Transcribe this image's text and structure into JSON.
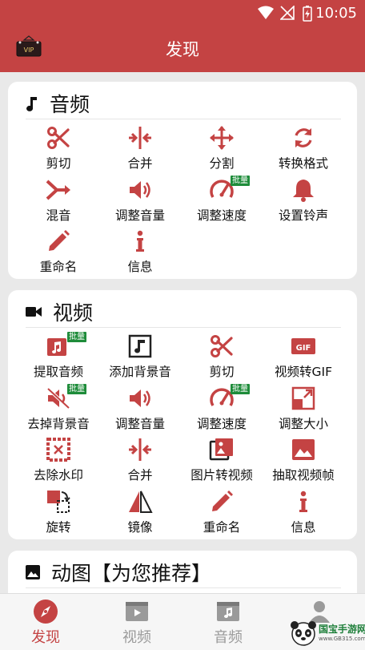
{
  "status": {
    "time": "10:05"
  },
  "header": {
    "title": "发现",
    "vip_logo_text": "VIP"
  },
  "audio": {
    "title": "音频",
    "items": [
      {
        "label": "剪切",
        "icon": "scissors-icon"
      },
      {
        "label": "合并",
        "icon": "merge-icon"
      },
      {
        "label": "分割",
        "icon": "split-icon"
      },
      {
        "label": "转换格式",
        "icon": "convert-icon"
      },
      {
        "label": "混音",
        "icon": "mix-icon"
      },
      {
        "label": "调整音量",
        "icon": "volume-icon"
      },
      {
        "label": "调整速度",
        "icon": "speed-icon",
        "badge": "批量"
      },
      {
        "label": "设置铃声",
        "icon": "bell-icon"
      },
      {
        "label": "重命名",
        "icon": "pencil-icon"
      },
      {
        "label": "信息",
        "icon": "info-icon"
      }
    ]
  },
  "video": {
    "title": "视频",
    "items": [
      {
        "label": "提取音频",
        "icon": "extract-audio-icon",
        "badge": "批量"
      },
      {
        "label": "添加背景音",
        "icon": "music-note-icon"
      },
      {
        "label": "剪切",
        "icon": "scissors-icon"
      },
      {
        "label": "视频转GIF",
        "icon": "gif-icon",
        "gif_text": "GIF"
      },
      {
        "label": "去掉背景音",
        "icon": "mute-icon",
        "badge": "批量"
      },
      {
        "label": "调整音量",
        "icon": "volume-icon"
      },
      {
        "label": "调整速度",
        "icon": "speed-icon",
        "badge": "批量"
      },
      {
        "label": "调整大小",
        "icon": "resize-icon"
      },
      {
        "label": "去除水印",
        "icon": "watermark-remove-icon"
      },
      {
        "label": "合并",
        "icon": "merge-icon"
      },
      {
        "label": "图片转视频",
        "icon": "images-icon"
      },
      {
        "label": "抽取视频帧",
        "icon": "image-icon"
      },
      {
        "label": "旋转",
        "icon": "rotate-icon"
      },
      {
        "label": "镜像",
        "icon": "mirror-icon"
      },
      {
        "label": "重命名",
        "icon": "pencil-icon"
      },
      {
        "label": "信息",
        "icon": "info-icon"
      }
    ]
  },
  "gif": {
    "title": "动图【为您推荐】"
  },
  "nav": {
    "items": [
      {
        "label": "发现",
        "icon": "compass-icon",
        "active": true
      },
      {
        "label": "视频",
        "icon": "video-tab-icon"
      },
      {
        "label": "音频",
        "icon": "audio-tab-icon"
      },
      {
        "label": "",
        "icon": "profile-icon"
      }
    ]
  },
  "watermark": {
    "text": "国宝手游网",
    "url_text": "www.GB315.com"
  },
  "colors": {
    "accent": "#c44343",
    "badge": "#1e8c3a",
    "nav_inactive": "#9a9a9a"
  }
}
